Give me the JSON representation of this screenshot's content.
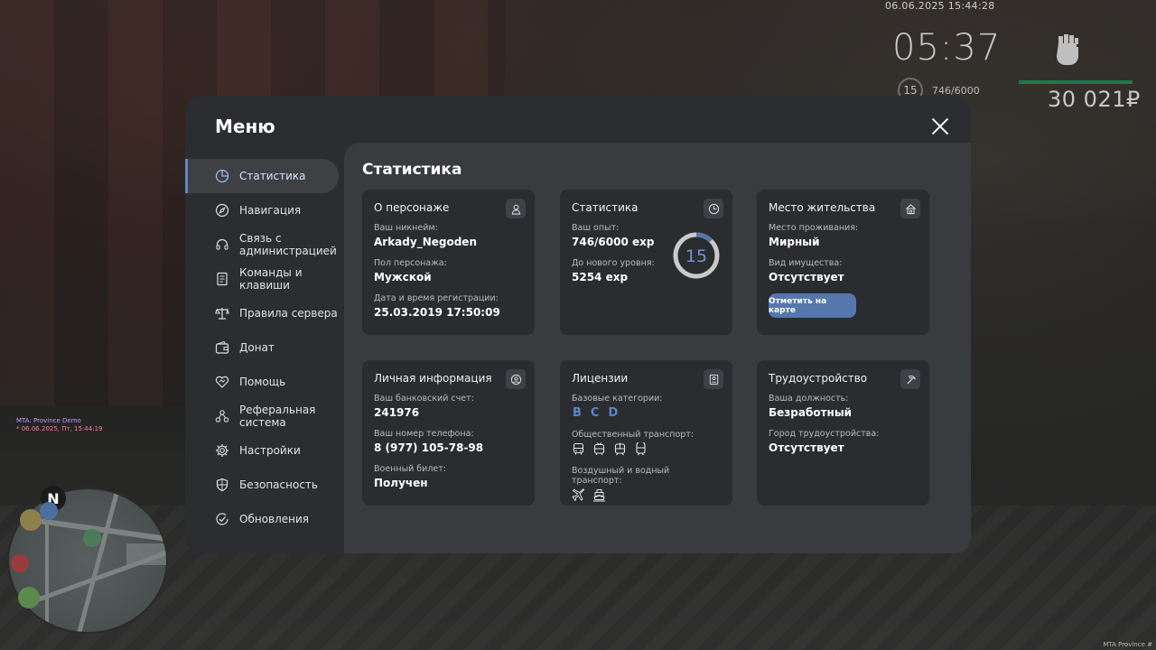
{
  "hud": {
    "datetime": "06.06.2025 15:44:28",
    "time": "05:37",
    "level": "15",
    "exp": "746/6000",
    "money": "30 021₽",
    "mta_line1": "MTA: Province Demo",
    "mta_line2": "* 06.06.2025, Пт, 15:44:19",
    "build_tag": "MTA Province #",
    "compass": "N",
    "health_bar_color": "#1c7a4c"
  },
  "menu": {
    "title": "Меню",
    "close_icon": "close-icon"
  },
  "sidebar": {
    "items": [
      {
        "label": "Статистика",
        "icon": "pie-chart-icon",
        "active": true
      },
      {
        "label": "Навигация",
        "icon": "compass-icon"
      },
      {
        "label": "Связь с администрацией",
        "icon": "headset-icon"
      },
      {
        "label": "Команды и клавиши",
        "icon": "document-icon"
      },
      {
        "label": "Правила сервера",
        "icon": "scales-icon"
      },
      {
        "label": "Донат",
        "icon": "wallet-icon"
      },
      {
        "label": "Помощь",
        "icon": "heart-handshake-icon"
      },
      {
        "label": "Реферальная система",
        "icon": "network-icon"
      },
      {
        "label": "Настройки",
        "icon": "gear-icon"
      },
      {
        "label": "Безопасность",
        "icon": "shield-icon"
      },
      {
        "label": "Обновления",
        "icon": "check-circle-icon"
      }
    ]
  },
  "content": {
    "title": "Статистика",
    "character": {
      "title": "О персонаже",
      "nickname_label": "Ваш никнейм:",
      "nickname": "Arkady_Negoden",
      "gender_label": "Пол персонажа:",
      "gender": "Мужской",
      "reg_label": "Дата и время регистрации:",
      "reg": "25.03.2019 17:50:09"
    },
    "stats": {
      "title": "Статистика",
      "exp_label": "Ваш опыт:",
      "exp": "746/6000 exp",
      "next_label": "До нового уровня:",
      "next": "5254 exp",
      "level": "15",
      "progress": 0.124,
      "ring_color": "#5577ad"
    },
    "residence": {
      "title": "Место жительства",
      "place_label": "Место проживания:",
      "place": "Мирный",
      "property_label": "Вид имущества:",
      "property": "Отсутствует",
      "map_button": "Отметить на карте"
    },
    "personal": {
      "title": "Личная информация",
      "bank_label": "Ваш банковский счет:",
      "bank": "241976",
      "phone_label": "Ваш номер телефона:",
      "phone": "8 (977) 105-78-98",
      "military_label": "Военный билет:",
      "military": "Получен"
    },
    "licenses": {
      "title": "Лицензии",
      "base_label": "Базовые категории:",
      "categories": [
        "B",
        "C",
        "D"
      ],
      "public_label": "Общественный транспорт:",
      "air_label": "Воздушный и водный транспорт:"
    },
    "job": {
      "title": "Трудоустройство",
      "position_label": "Ваша должность:",
      "position": "Безработный",
      "city_label": "Город трудоустройства:",
      "city": "Отсутствует"
    }
  },
  "colors": {
    "accent": "#5b86c9",
    "panel": "#2c2d30",
    "content": "#3a3b3f",
    "card": "#2b2c30"
  }
}
